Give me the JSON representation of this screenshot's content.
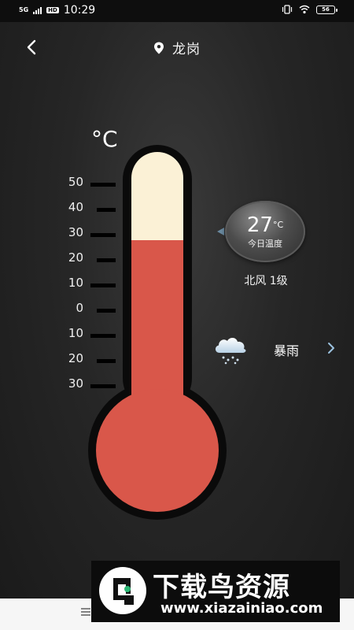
{
  "status_bar": {
    "network": "5G",
    "hd": "HD",
    "time": "10:29",
    "battery": "56"
  },
  "header": {
    "location": "龙岗"
  },
  "thermometer": {
    "unit": "°C",
    "scale": [
      "50",
      "40",
      "30",
      "20",
      "10",
      "0",
      "10",
      "20",
      "30"
    ],
    "mercury_level_value": 27,
    "mercury_color": "#d9574a",
    "empty_color": "#fbf1d6"
  },
  "weather": {
    "temperature": "27",
    "temperature_unit": "°C",
    "temperature_caption": "今日温度",
    "wind": "北风 1级",
    "condition": "暴雨"
  },
  "watermark": {
    "title": "下载鸟资源",
    "url": "www.xiazainiao.com"
  },
  "icons": [
    "back-icon",
    "location-pin-icon",
    "rain-cloud-icon",
    "chevron-right-icon",
    "menu-icon",
    "wifi-icon",
    "vibrate-icon"
  ]
}
